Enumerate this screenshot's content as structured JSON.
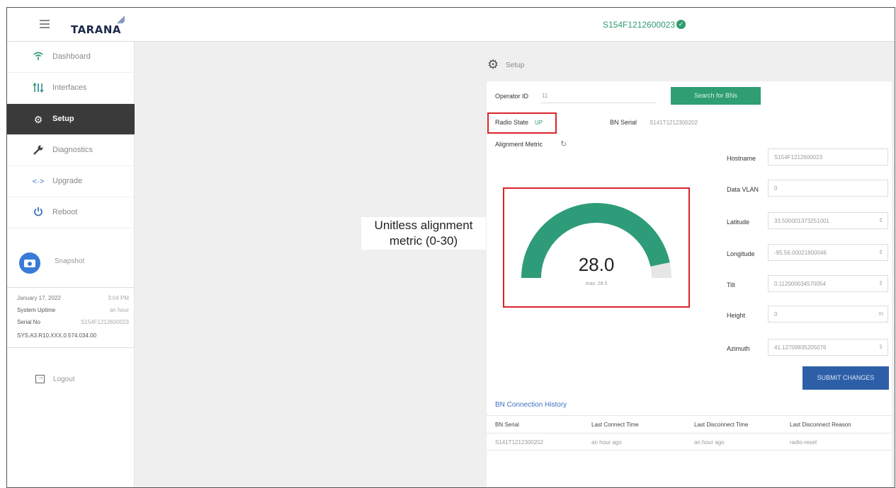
{
  "header": {
    "logo_text": "TARANA",
    "device_title": "S154F1212600023"
  },
  "sidebar": {
    "items": [
      {
        "label": "Dashboard",
        "icon": "wifi-icon"
      },
      {
        "label": "Interfaces",
        "icon": "interfaces-icon"
      },
      {
        "label": "Setup",
        "icon": "gear-icon",
        "active": true
      },
      {
        "label": "Diagnostics",
        "icon": "wrench-icon"
      },
      {
        "label": "Upgrade",
        "icon": "upgrade-icon"
      },
      {
        "label": "Reboot",
        "icon": "power-icon"
      }
    ],
    "snapshot_label": "Snapshot",
    "system": {
      "date": "January 17, 2022",
      "time": "3:04 PM",
      "uptime_label": "System Uptime",
      "uptime_value": "an hour",
      "serial_label": "Serial No",
      "serial_value": "S154F1212600023",
      "version": "SYS.A3.R10.XXX.0.574.034.00"
    },
    "logout_label": "Logout"
  },
  "main": {
    "page_title": "Setup",
    "annotation": "Unitless alignment metric (0-30)",
    "operator_label": "Operator ID",
    "operator_value": "11",
    "search_button": "Search for BNs",
    "radio_state_label": "Radio State",
    "radio_state_value": "UP",
    "bn_serial_label": "BN Serial",
    "bn_serial_value": "S141T1212300202",
    "alignment_label": "Alignment Metric",
    "gauge": {
      "value": 28.0,
      "max": 28.5,
      "scale_max": 30,
      "value_text": "28.0",
      "max_text": "max: 28.5",
      "fill_color": "#2e9c78",
      "track_color": "#e6e6e6"
    },
    "fields": [
      {
        "label": "Hostname",
        "value": "S154F1212600023"
      },
      {
        "label": "Data VLAN",
        "value": "0"
      },
      {
        "label": "Latitude",
        "value": "33.500001373251001"
      },
      {
        "label": "Longitude",
        "value": "-95.56.00021800046"
      },
      {
        "label": "Tilt",
        "value": "0.112000034570054"
      },
      {
        "label": "Height",
        "value": "0",
        "unit": "m"
      },
      {
        "label": "Azimuth",
        "value": "41.12709835205076"
      }
    ],
    "submit_button": "SUBMIT CHANGES",
    "history": {
      "title": "BN Connection History",
      "columns": [
        "BN Serial",
        "Last Connect Time",
        "Last Disconnect Time",
        "Last Disconnect Reason"
      ],
      "rows": [
        [
          "S141T1212300202",
          "an hour ago",
          "an hour ago",
          "radio-reset"
        ]
      ]
    }
  }
}
